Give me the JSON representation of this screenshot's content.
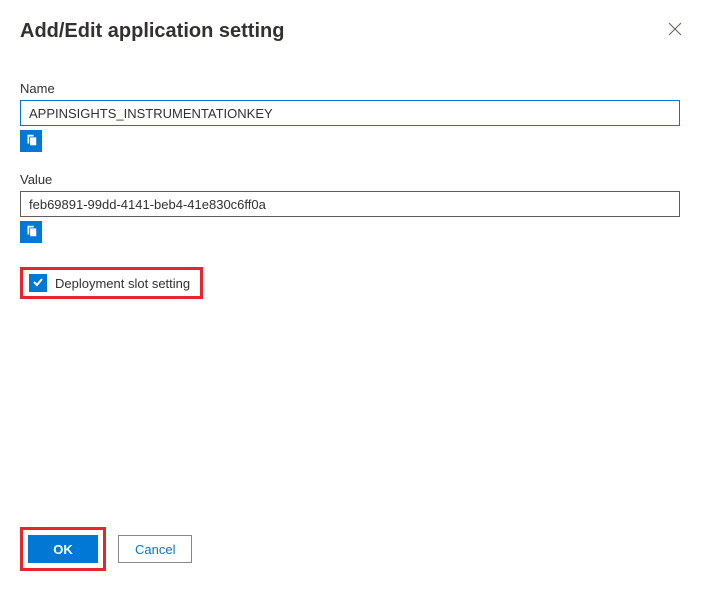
{
  "dialog": {
    "title": "Add/Edit application setting"
  },
  "fields": {
    "name": {
      "label": "Name",
      "value": "APPINSIGHTS_INSTRUMENTATIONKEY"
    },
    "value": {
      "label": "Value",
      "value": "feb69891-99dd-4141-beb4-41e830c6ff0a"
    },
    "slot": {
      "label": "Deployment slot setting",
      "checked": true
    }
  },
  "buttons": {
    "ok": "OK",
    "cancel": "Cancel"
  },
  "icons": {
    "copy": "copy-icon",
    "close": "close-icon",
    "check": "check-icon"
  }
}
